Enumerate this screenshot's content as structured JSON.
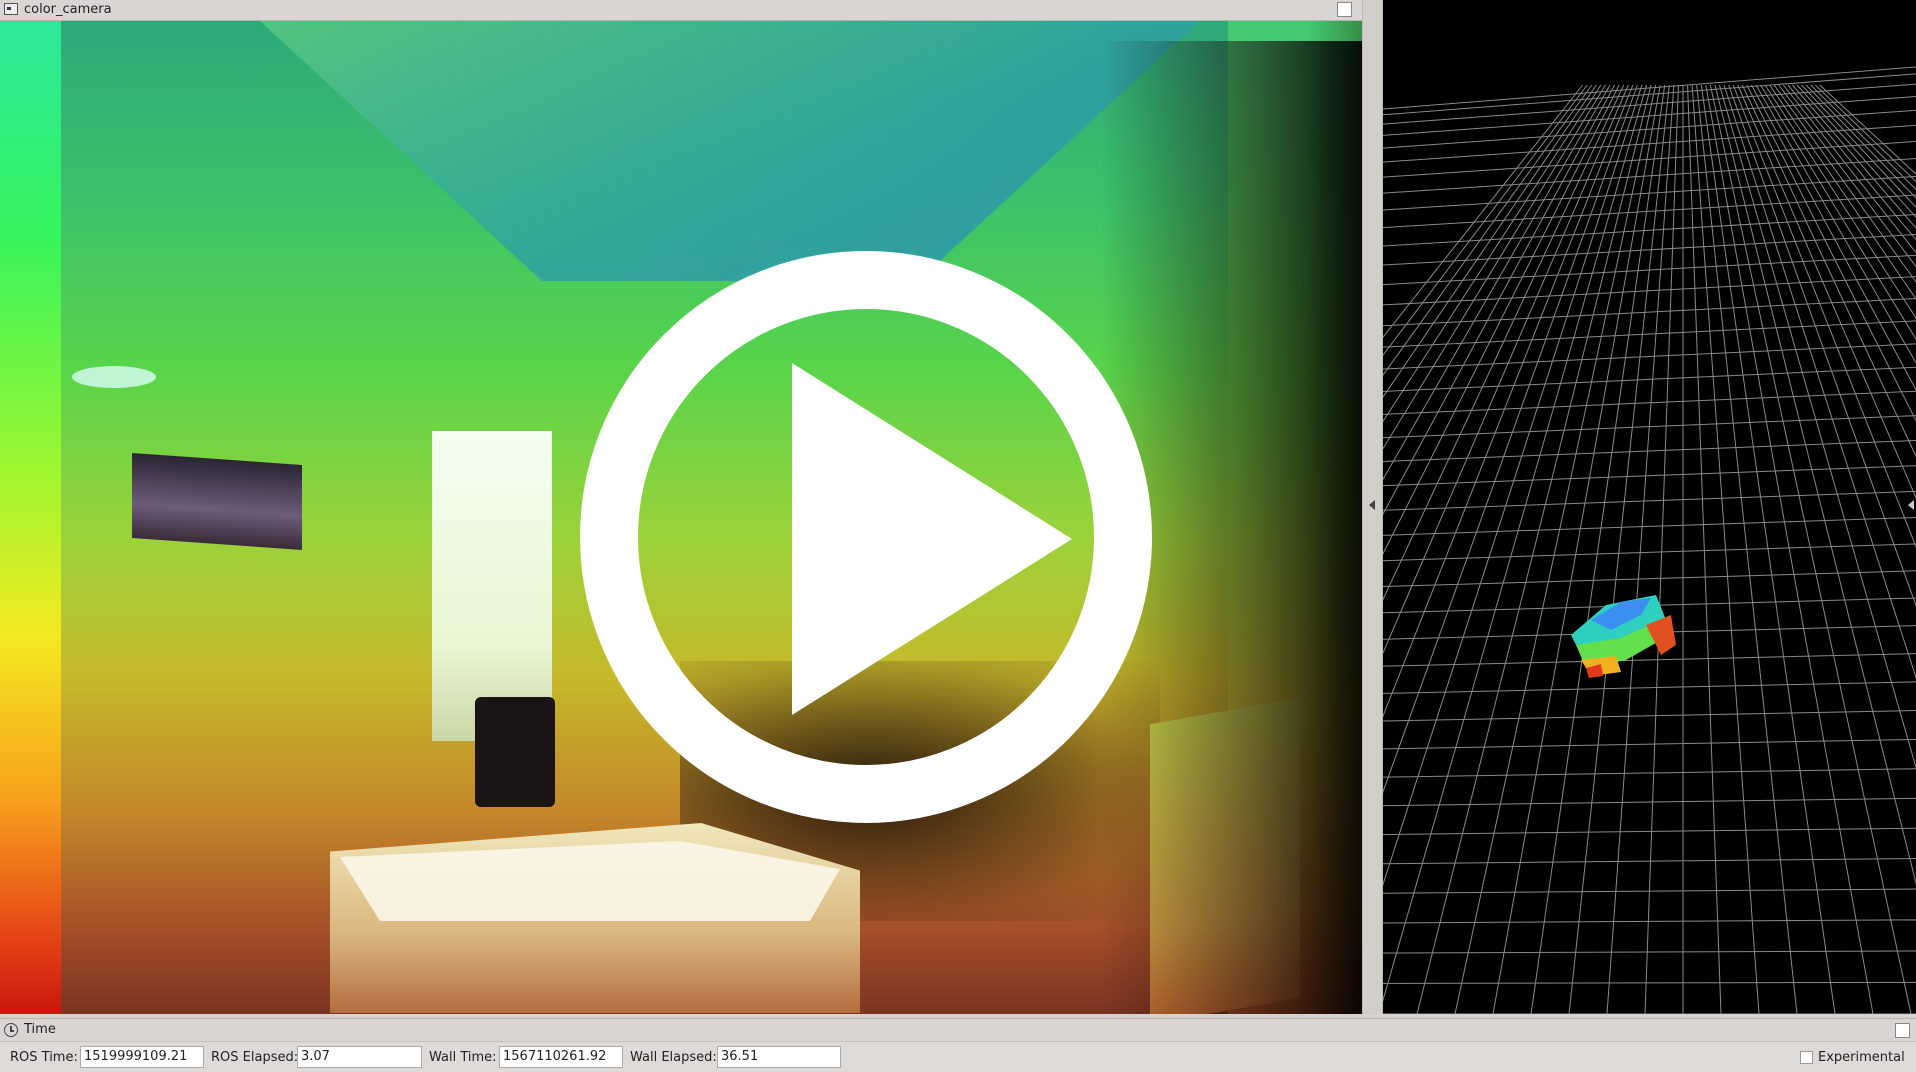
{
  "camera_panel": {
    "title": "color_camera"
  },
  "time_panel": {
    "title": "Time",
    "ros_time_label": "ROS Time:",
    "ros_time_value": "1519999109.21",
    "ros_elapsed_label": "ROS Elapsed:",
    "ros_elapsed_value": "3.07",
    "wall_time_label": "Wall Time:",
    "wall_time_value": "1567110261.92",
    "wall_elapsed_label": "Wall Elapsed:",
    "wall_elapsed_value": "36.51",
    "experimental_label": "Experimental",
    "experimental_checked": false
  },
  "icons": {
    "camera_panel": "image-panel-icon",
    "overlay": "play-icon",
    "time_panel": "clock-icon"
  },
  "colors": {
    "panel_bg": "#d9d5d2",
    "view_bg": "#000000",
    "grid_line": "#8a8a8a",
    "overlay": "#ffffff"
  }
}
